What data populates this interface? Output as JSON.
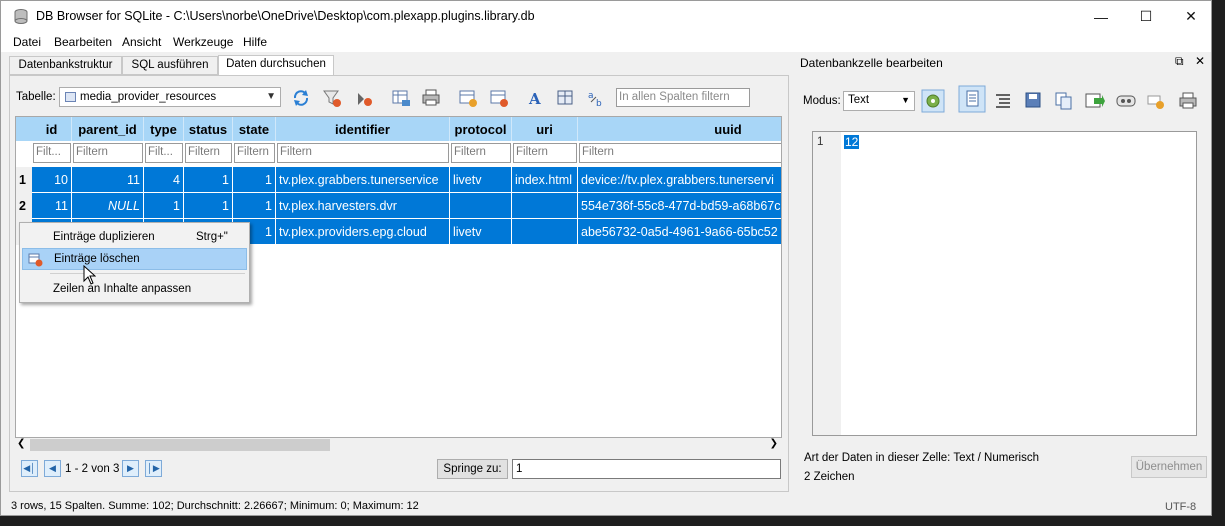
{
  "window": {
    "title": "DB Browser for SQLite - C:\\Users\\norbe\\OneDrive\\Desktop\\com.plexapp.plugins.library.db",
    "controls": {
      "minimize": "—",
      "maximize": "☐",
      "close": "✕"
    }
  },
  "menu": [
    "Datei",
    "Bearbeiten",
    "Ansicht",
    "Werkzeuge",
    "Hilfe"
  ],
  "tabs": [
    "Datenbankstruktur",
    "SQL ausführen",
    "Daten durchsuchen"
  ],
  "active_tab": "Daten durchsuchen",
  "toolbar": {
    "table_label": "Tabelle:",
    "table_value": "media_provider_resources",
    "search_placeholder": "In allen Spalten filtern"
  },
  "grid": {
    "columns": [
      "id",
      "parent_id",
      "type",
      "status",
      "state",
      "identifier",
      "protocol",
      "uri",
      "uuid"
    ],
    "filters": [
      "Filt...",
      "Filtern",
      "Filt...",
      "Filtern",
      "Filtern",
      "Filtern",
      "Filtern",
      "Filtern",
      "Filtern"
    ],
    "rows": [
      {
        "num": "1",
        "cells": [
          "10",
          "11",
          "4",
          "1",
          "1",
          "tv.plex.grabbers.tunerservice",
          "livetv",
          "index.html",
          "device://tv.plex.grabbers.tunerservi"
        ]
      },
      {
        "num": "2",
        "cells": [
          "11",
          "NULL",
          "1",
          "1",
          "1",
          "tv.plex.harvesters.dvr",
          "",
          "",
          "554e736f-55c8-477d-bd59-a68b67c"
        ]
      },
      {
        "num": "3",
        "cells": [
          "",
          "",
          "",
          "",
          "1",
          "tv.plex.providers.epg.cloud",
          "livetv",
          "",
          "abe56732-0a5d-4961-9a66-65bc52"
        ]
      }
    ]
  },
  "nav": {
    "range": "1 - 2 von 3",
    "goto_label": "Springe zu:",
    "goto_value": "1"
  },
  "status": {
    "left": "3 rows, 15 Spalten. Summe: 102; Durchschnitt: 2.26667; Minimum: 0; Maximum: 12",
    "encoding": "UTF-8"
  },
  "edit_cell": {
    "title": "Datenbankzelle bearbeiten",
    "mode_label": "Modus:",
    "mode_value": "Text",
    "line_number": "1",
    "value": "12",
    "type_info": "Art der Daten in dieser Zelle: Text / Numerisch",
    "size_info": "2 Zeichen",
    "apply_label": "Übernehmen"
  },
  "context_menu": {
    "items": [
      {
        "label": "Einträge duplizieren",
        "shortcut": "Strg+\""
      },
      {
        "label": "Einträge löschen",
        "shortcut": ""
      },
      {
        "label": "Zeilen an Inhalte anpassen",
        "shortcut": ""
      }
    ],
    "highlighted_index": 1
  },
  "colors": {
    "selection": "#0078d7",
    "header": "#a8d6f7",
    "menu_highlight": "#a9d2f7"
  }
}
